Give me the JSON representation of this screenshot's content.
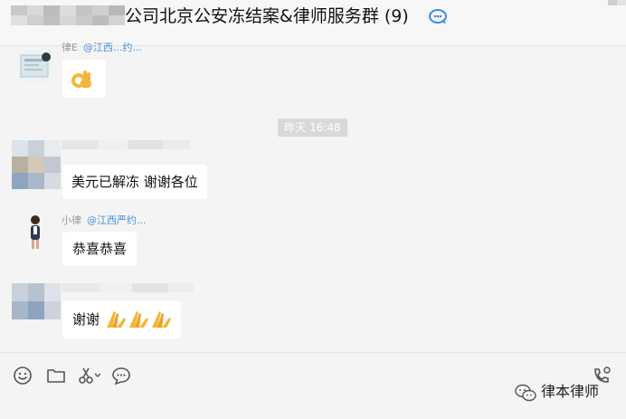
{
  "header": {
    "title": "公司北京公安冻结案&律师服务群 (9)",
    "chat_icon": "group-chat-icon"
  },
  "messages": {
    "m1": {
      "sender": "律E",
      "at": "@江西...约...",
      "content_icon": "ok-hand-emoji"
    },
    "time_divider": "昨天 16:48",
    "m2": {
      "text": "美元已解冻  谢谢各位"
    },
    "m3": {
      "sender": "小律",
      "at": "@江西严约...",
      "text": "恭喜恭喜"
    },
    "m4": {
      "text": "谢谢",
      "emoji_icon": "folded-hands-emoji",
      "emoji_count": 3
    }
  },
  "toolbar": {
    "icons": [
      "emoji-icon",
      "folder-icon",
      "scissors-icon",
      "chat-bubble-icon",
      "call-icon"
    ]
  },
  "watermark": {
    "text": "律本律师"
  },
  "colors": {
    "background": "#f4f4f4",
    "bubble": "#ffffff",
    "time_badge": "#d9d9d9",
    "at_link": "#4a90d9"
  }
}
